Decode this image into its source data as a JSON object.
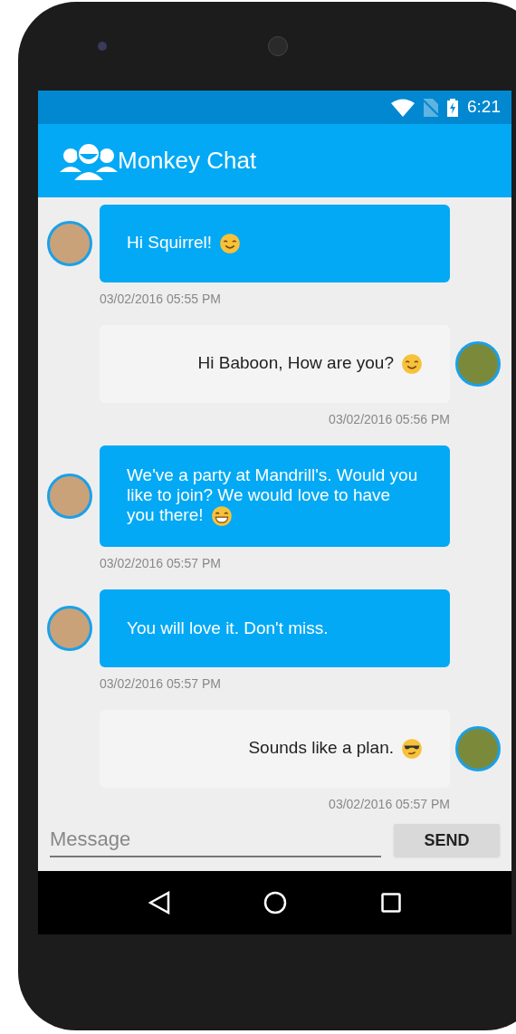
{
  "status_bar": {
    "time": "6:21"
  },
  "app_bar": {
    "title": "Monkey Chat"
  },
  "messages": [
    {
      "kind": "incoming",
      "text": "Hi Squirrel!",
      "emoji": {
        "kind": "smile"
      },
      "time": "03/02/2016 05:55 PM"
    },
    {
      "kind": "outgoing",
      "text": "Hi Baboon, How are you?",
      "emoji": {
        "kind": "smile"
      },
      "time": "03/02/2016 05:56 PM"
    },
    {
      "kind": "incoming",
      "text": "We've a party at Mandrill's. Would you like to join? We would love to have you there!",
      "emoji": {
        "kind": "grin"
      },
      "time": "03/02/2016 05:57 PM"
    },
    {
      "kind": "incoming",
      "text": "You will love it. Don't miss.",
      "time": "03/02/2016 05:57 PM"
    },
    {
      "kind": "outgoing",
      "text": "Sounds like a plan.",
      "emoji": {
        "kind": "sunglasses"
      },
      "time": "03/02/2016 05:57 PM"
    }
  ],
  "composer": {
    "placeholder": "Message",
    "button": "SEND"
  }
}
